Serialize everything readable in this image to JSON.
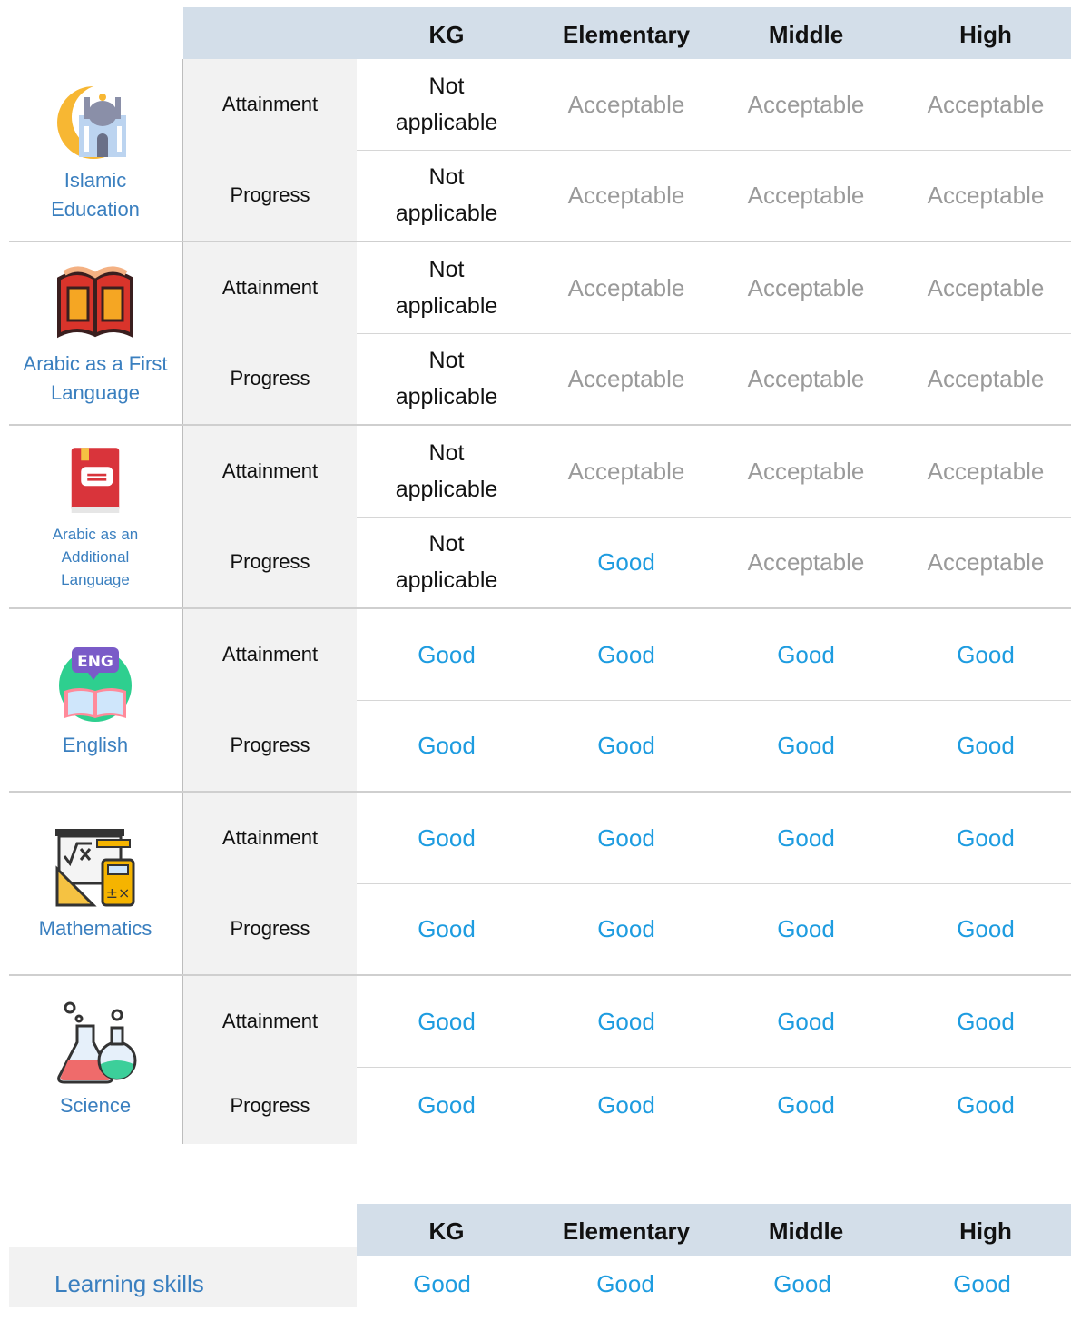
{
  "table1": {
    "headers": [
      "KG",
      "Elementary",
      "Middle",
      "High"
    ],
    "subjects": [
      {
        "name": "Islamic Education",
        "icon": "mosque-icon",
        "rows": [
          {
            "label": "Attainment",
            "values": [
              "Not applicable",
              "Acceptable",
              "Acceptable",
              "Acceptable"
            ]
          },
          {
            "label": "Progress",
            "values": [
              "Not applicable",
              "Acceptable",
              "Acceptable",
              "Acceptable"
            ]
          }
        ]
      },
      {
        "name": "Arabic as a First Language",
        "icon": "open-book-icon",
        "rows": [
          {
            "label": "Attainment",
            "values": [
              "Not applicable",
              "Acceptable",
              "Acceptable",
              "Acceptable"
            ]
          },
          {
            "label": "Progress",
            "values": [
              "Not applicable",
              "Acceptable",
              "Acceptable",
              "Acceptable"
            ]
          }
        ]
      },
      {
        "name": "Arabic as an Additional Language",
        "icon": "closed-book-icon",
        "rows": [
          {
            "label": "Attainment",
            "values": [
              "Not applicable",
              "Acceptable",
              "Acceptable",
              "Acceptable"
            ]
          },
          {
            "label": "Progress",
            "values": [
              "Not applicable",
              "Good",
              "Acceptable",
              "Acceptable"
            ]
          }
        ]
      },
      {
        "name": "English",
        "icon": "eng-speech-book-icon",
        "rows": [
          {
            "label": "Attainment",
            "values": [
              "Good",
              "Good",
              "Good",
              "Good"
            ]
          },
          {
            "label": "Progress",
            "values": [
              "Good",
              "Good",
              "Good",
              "Good"
            ]
          }
        ]
      },
      {
        "name": "Mathematics",
        "icon": "math-board-calculator-icon",
        "rows": [
          {
            "label": "Attainment",
            "values": [
              "Good",
              "Good",
              "Good",
              "Good"
            ]
          },
          {
            "label": "Progress",
            "values": [
              "Good",
              "Good",
              "Good",
              "Good"
            ]
          }
        ]
      },
      {
        "name": "Science",
        "icon": "flasks-icon",
        "rows": [
          {
            "label": "Attainment",
            "values": [
              "Good",
              "Good",
              "Good",
              "Good"
            ]
          },
          {
            "label": "Progress",
            "values": [
              "Good",
              "Good",
              "Good",
              "Good"
            ]
          }
        ]
      }
    ]
  },
  "table2": {
    "headers": [
      "KG",
      "Elementary",
      "Middle",
      "High"
    ],
    "rows": [
      {
        "label": "Learning skills",
        "values": [
          "Good",
          "Good",
          "Good",
          "Good"
        ]
      }
    ]
  },
  "colors": {
    "header_bg": "#d3dee9",
    "good": "#1e9ce0",
    "acceptable": "#9a9a9a",
    "subject_label": "#3a7fbf",
    "row_label_bg": "#f2f2f2"
  }
}
